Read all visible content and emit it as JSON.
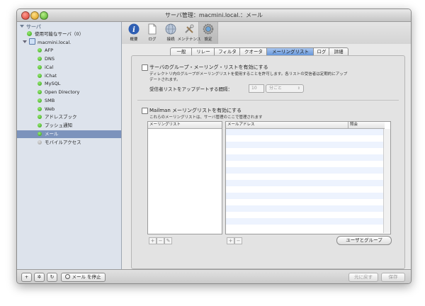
{
  "window": {
    "title": "サーバ管理：macmini.local.：メール"
  },
  "sidebar": {
    "header": "サーバ",
    "available_servers": "使用可能なサーバ（0）",
    "host": "macmini.local.",
    "services": [
      {
        "label": "AFP",
        "status": "green"
      },
      {
        "label": "DNS",
        "status": "green"
      },
      {
        "label": "iCal",
        "status": "green"
      },
      {
        "label": "iChat",
        "status": "green"
      },
      {
        "label": "MySQL",
        "status": "green"
      },
      {
        "label": "Open Directory",
        "status": "green"
      },
      {
        "label": "SMB",
        "status": "green"
      },
      {
        "label": "Web",
        "status": "green"
      },
      {
        "label": "アドレスブック",
        "status": "green"
      },
      {
        "label": "プッシュ通知",
        "status": "green"
      },
      {
        "label": "メール",
        "status": "green",
        "selected": true
      },
      {
        "label": "モバイルアクセス",
        "status": "gray"
      }
    ]
  },
  "toolbar": {
    "items": [
      {
        "label": "概要"
      },
      {
        "label": "ログ"
      },
      {
        "label": "接続"
      },
      {
        "label": "メンテナンス"
      },
      {
        "label": "設定",
        "active": true
      }
    ]
  },
  "tabs": [
    {
      "label": "一般"
    },
    {
      "label": "リレー"
    },
    {
      "label": "フィルタ"
    },
    {
      "label": "クオータ"
    },
    {
      "label": "メーリングリスト",
      "active": true
    },
    {
      "label": "ログ"
    },
    {
      "label": "詳細"
    }
  ],
  "group_lists": {
    "checkbox_label": "サーバのグループ・メーリング・リストを有効にする",
    "description_line1": "ディレクトリ内のグループがメーリングリストを使用することを許可します。各リストの受信者は定期的にアップ",
    "description_line2": "デートされます。",
    "update_label": "受信者リストをアップデートする間隔：",
    "interval_value": "10",
    "interval_unit": "分ごと"
  },
  "mailman": {
    "checkbox_label": "Mailman メーリングリストを有効にする",
    "description": "これらのメーリングリストは、サーバ管理のここで管理されます",
    "list_column": "メーリングリスト",
    "address_column": "メールアドレス",
    "moderator_column": "照会",
    "users_groups_button": "ユーザとグループ"
  },
  "bottom": {
    "add": "+",
    "gear": "✲",
    "refresh": "↻",
    "stop_mail": "メール を停止",
    "revert": "元に戻す",
    "save": "保存"
  },
  "mini": {
    "plus": "+",
    "minus": "−",
    "edit": "✎"
  },
  "colors": {
    "selection": "#7c93bc",
    "active_tab": "#5f92d8",
    "status_green": "#2d9b14"
  }
}
